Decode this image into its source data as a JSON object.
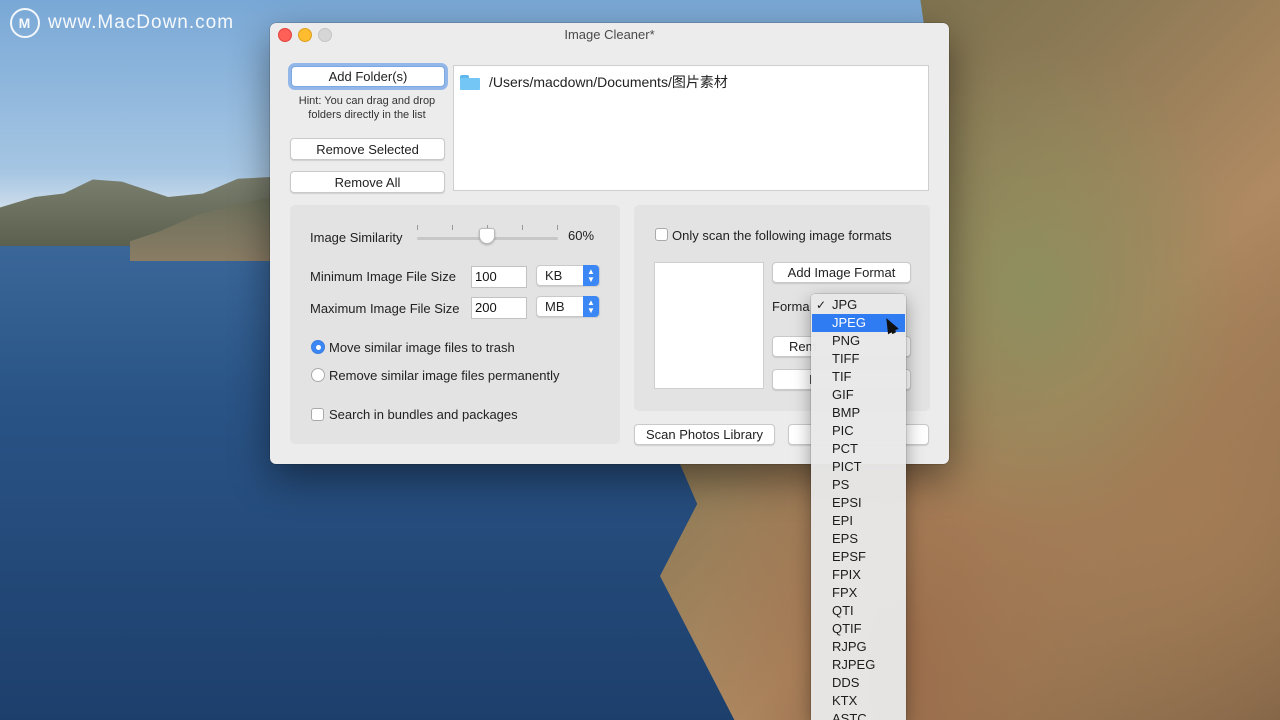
{
  "watermark": {
    "logo": "M",
    "text": "www.MacDown.com"
  },
  "window": {
    "title": "Image Cleaner*"
  },
  "folders": {
    "add_button": "Add Folder(s)",
    "hint": "Hint: You can drag and drop folders directly in the list",
    "remove_selected_button": "Remove Selected",
    "remove_all_button": "Remove All",
    "items": [
      {
        "icon": "folder-icon",
        "path": "/Users/macdown/Documents/图片素材"
      }
    ]
  },
  "settings": {
    "similarity_label": "Image Similarity",
    "similarity_value": "60%",
    "similarity_level": 0.6,
    "min_size_label": "Minimum Image File Size",
    "min_size_value": "100",
    "min_size_unit": "KB",
    "max_size_label": "Maximum Image File Size",
    "max_size_value": "200",
    "max_size_unit": "MB",
    "radio_options": [
      {
        "label": "Move similar image files to trash",
        "selected": true
      },
      {
        "label": "Remove similar image files permanently",
        "selected": false
      }
    ],
    "bundles_label": "Search in bundles and packages",
    "bundles_checked": false
  },
  "formats": {
    "only_scan_label": "Only scan the following image formats",
    "only_scan_checked": false,
    "add_button": "Add Image Format",
    "format_label": "Forma",
    "remove_button_partial": "Rem",
    "last_button_partial": "I",
    "scan_photos_button": "Scan Photos Library"
  },
  "format_menu": {
    "selected_check": "✓",
    "highlight_color": "#2f7bf2",
    "items": [
      "JPG",
      "JPEG",
      "PNG",
      "TIFF",
      "TIF",
      "GIF",
      "BMP",
      "PIC",
      "PCT",
      "PICT",
      "PS",
      "EPSI",
      "EPI",
      "EPS",
      "EPSF",
      "FPIX",
      "FPX",
      "QTI",
      "QTIF",
      "RJPG",
      "RJPEG",
      "DDS",
      "KTX",
      "ASTC"
    ],
    "checked_index": 0,
    "highlighted_index": 1
  },
  "colors": {
    "accent": "#3b87f5",
    "close": "#fe5f57",
    "minimize": "#febc2e",
    "zoom_disabled": "#d6d6d6"
  }
}
